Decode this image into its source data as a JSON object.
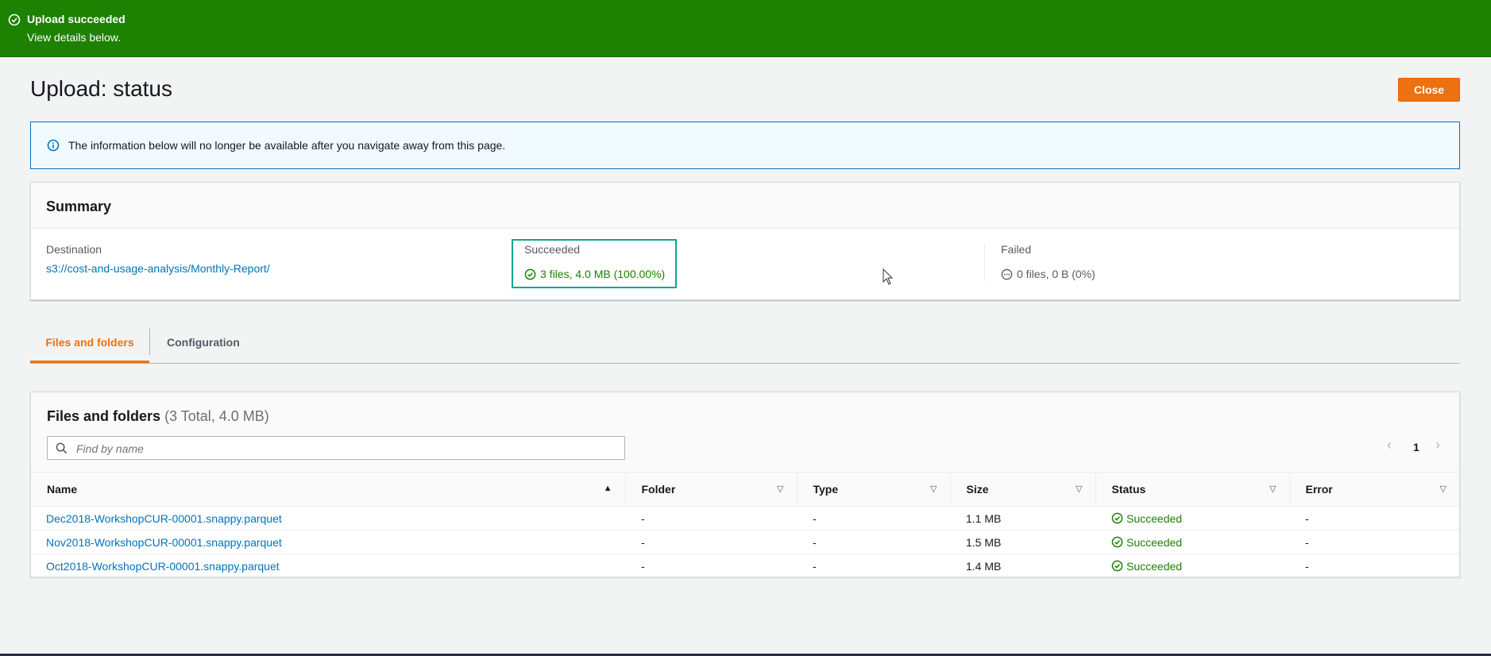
{
  "banner": {
    "title": "Upload succeeded",
    "subtitle": "View details below.",
    "icon": "check-circle-icon",
    "color": "#1d8102"
  },
  "page": {
    "title": "Upload: status",
    "close_label": "Close"
  },
  "info": {
    "text": "The information below will no longer be available after you navigate away from this page.",
    "icon": "info-circle-icon"
  },
  "summary": {
    "title": "Summary",
    "destination_label": "Destination",
    "destination_value": "s3://cost-and-usage-analysis/Monthly-Report/",
    "succeeded_label": "Succeeded",
    "succeeded_value": "3 files, 4.0 MB (100.00%)",
    "failed_label": "Failed",
    "failed_value": "0 files, 0 B (0%)"
  },
  "tabs": [
    {
      "label": "Files and folders",
      "active": true
    },
    {
      "label": "Configuration",
      "active": false
    }
  ],
  "files": {
    "title": "Files and folders",
    "count": "(3 Total, 4.0 MB)",
    "search_placeholder": "Find by name",
    "page_number": "1",
    "columns": [
      "Name",
      "Folder",
      "Type",
      "Size",
      "Status",
      "Error"
    ],
    "rows": [
      {
        "name": "Dec2018-WorkshopCUR-00001.snappy.parquet",
        "folder": "-",
        "type": "-",
        "size": "1.1 MB",
        "status": "Succeeded",
        "error": "-"
      },
      {
        "name": "Nov2018-WorkshopCUR-00001.snappy.parquet",
        "folder": "-",
        "type": "-",
        "size": "1.5 MB",
        "status": "Succeeded",
        "error": "-"
      },
      {
        "name": "Oct2018-WorkshopCUR-00001.snappy.parquet",
        "folder": "-",
        "type": "-",
        "size": "1.4 MB",
        "status": "Succeeded",
        "error": "-"
      }
    ]
  },
  "colors": {
    "accent": "#ec7211",
    "link": "#0073bb",
    "success": "#1d8102"
  }
}
